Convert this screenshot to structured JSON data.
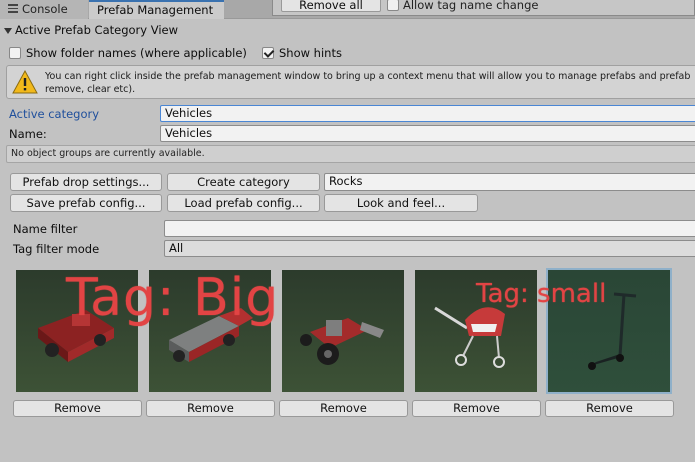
{
  "tabs": [
    {
      "label": "Console"
    },
    {
      "label": "Prefab Management"
    }
  ],
  "popup": {
    "remove_all_label": "Remove all",
    "allow_tag_label": "Allow tag name change"
  },
  "foldout": {
    "label": "Active Prefab Category View"
  },
  "options": {
    "show_folder_names": {
      "label": "Show folder names (where applicable)",
      "checked": false
    },
    "show_hints": {
      "label": "Show hints",
      "checked": true
    }
  },
  "help": {
    "line1": "You can right click inside the prefab management window to bring up a context menu that will allow you to manage prefabs and prefab",
    "line2": "remove, clear etc)."
  },
  "category": {
    "active_label": "Active category",
    "active_value": "Vehicles",
    "name_label": "Name:",
    "name_value": "Vehicles"
  },
  "info": {
    "object_groups": "No object groups are currently available."
  },
  "actions": {
    "prefab_drop_settings": "Prefab drop settings...",
    "create_category": "Create category",
    "new_category_value": "Rocks",
    "save_prefab_config": "Save prefab config...",
    "load_prefab_config": "Load prefab config...",
    "look_and_feel": "Look and feel..."
  },
  "filters": {
    "name_filter_label": "Name filter",
    "name_filter_value": "",
    "tag_filter_mode_label": "Tag filter mode",
    "tag_filter_mode_value": "All"
  },
  "overlays": {
    "tag_big": "Tag: Big",
    "tag_small": "Tag: small"
  },
  "prefabs": [
    {
      "name": "harvester",
      "remove_label": "Remove"
    },
    {
      "name": "truck",
      "remove_label": "Remove"
    },
    {
      "name": "tractor",
      "remove_label": "Remove"
    },
    {
      "name": "stroller",
      "remove_label": "Remove"
    },
    {
      "name": "scooter",
      "remove_label": "Remove",
      "selected": true
    }
  ],
  "colors": {
    "accent": "#3a72b0",
    "tag_text": "#e24444",
    "selection": "#8fb0c9"
  }
}
